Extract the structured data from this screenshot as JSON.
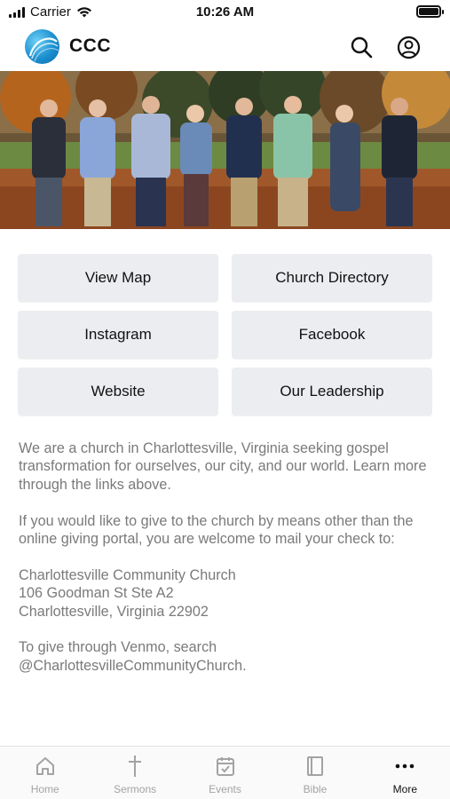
{
  "status_bar": {
    "carrier": "Carrier",
    "time": "10:26 AM"
  },
  "header": {
    "title": "CCC",
    "logo_icon": "ccc-wave-logo",
    "search_icon": "search-icon",
    "account_icon": "account-circle-icon"
  },
  "hero": {
    "description_icon": "group-photo-image"
  },
  "links": [
    {
      "label": "View Map"
    },
    {
      "label": "Church Directory"
    },
    {
      "label": "Instagram"
    },
    {
      "label": "Facebook"
    },
    {
      "label": "Website"
    },
    {
      "label": "Our Leadership"
    }
  ],
  "content": {
    "paragraph_1": "We are a church in Charlottesville, Virginia seeking gospel transformation for ourselves, our city, and our world. Learn more through the links above.",
    "paragraph_2": "If you would like to give to the church by means other than the online giving portal, you are welcome to mail your check to:",
    "address_line_1": "Charlottesville Community Church",
    "address_line_2": "106 Goodman St Ste A2",
    "address_line_3": "Charlottesville, Virginia 22902",
    "paragraph_4_line_1": "To give through Venmo, search",
    "paragraph_4_line_2": "@CharlottesvilleCommunityChurch."
  },
  "tabs": [
    {
      "label": "Home",
      "icon": "home-icon"
    },
    {
      "label": "Sermons",
      "icon": "cross-icon"
    },
    {
      "label": "Events",
      "icon": "calendar-check-icon"
    },
    {
      "label": "Bible",
      "icon": "book-icon"
    },
    {
      "label": "More",
      "icon": "more-dots-icon",
      "active": true
    }
  ],
  "colors": {
    "button_bg": "#ebedf0",
    "body_text": "#7a7a7a",
    "tab_inactive": "#a3a3a3",
    "tab_active": "#111111",
    "logo_blue": "#1b8fd0"
  }
}
